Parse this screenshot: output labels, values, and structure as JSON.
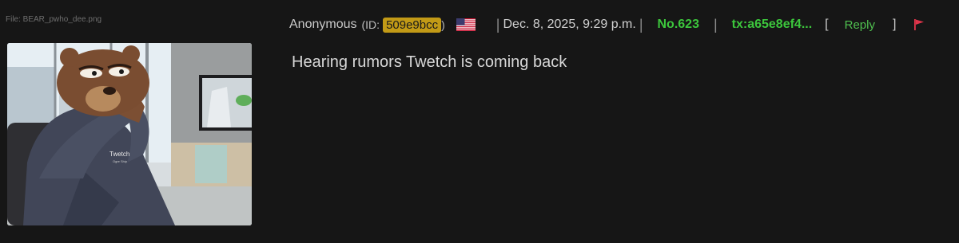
{
  "file": {
    "label": "File: BEAR_pwho_dee.png",
    "thumbnail_text": "Twetch",
    "thumbnail_subtext": "Ogre Ship"
  },
  "header": {
    "name": "Anonymous",
    "id_prefix": "(ID:",
    "id_value": "509e9bcc",
    "id_suffix": ")",
    "flag_icon": "us-flag-icon",
    "separator": "|",
    "date": "Dec. 8, 2025, 9:29 p.m.",
    "post_number": "No.623",
    "tx": "tx:a65e8ef4...",
    "reply_open": "[",
    "reply_label": "Reply",
    "reply_close": "]",
    "report_icon": "flag-icon"
  },
  "message": "Hearing rumors Twetch is coming back",
  "colors": {
    "background": "#161616",
    "id_badge": "#c29a16",
    "green": "#3cc63c",
    "report_flag": "#e0344a"
  }
}
